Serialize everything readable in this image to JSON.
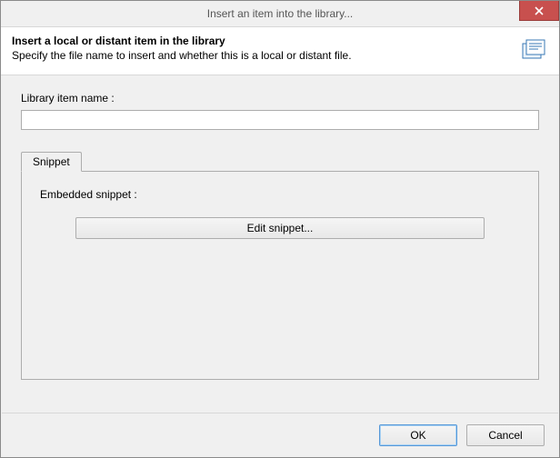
{
  "window": {
    "title": "Insert an item into the library..."
  },
  "header": {
    "title": "Insert a local or distant item in the library",
    "subtitle": "Specify the file name to insert and whether this is a local or distant file."
  },
  "form": {
    "library_item_label": "Library item name :",
    "library_item_value": ""
  },
  "tabs": {
    "snippet_label": "Snippet"
  },
  "snippet_panel": {
    "embedded_label": "Embedded snippet :",
    "edit_button": "Edit snippet..."
  },
  "footer": {
    "ok": "OK",
    "cancel": "Cancel"
  }
}
